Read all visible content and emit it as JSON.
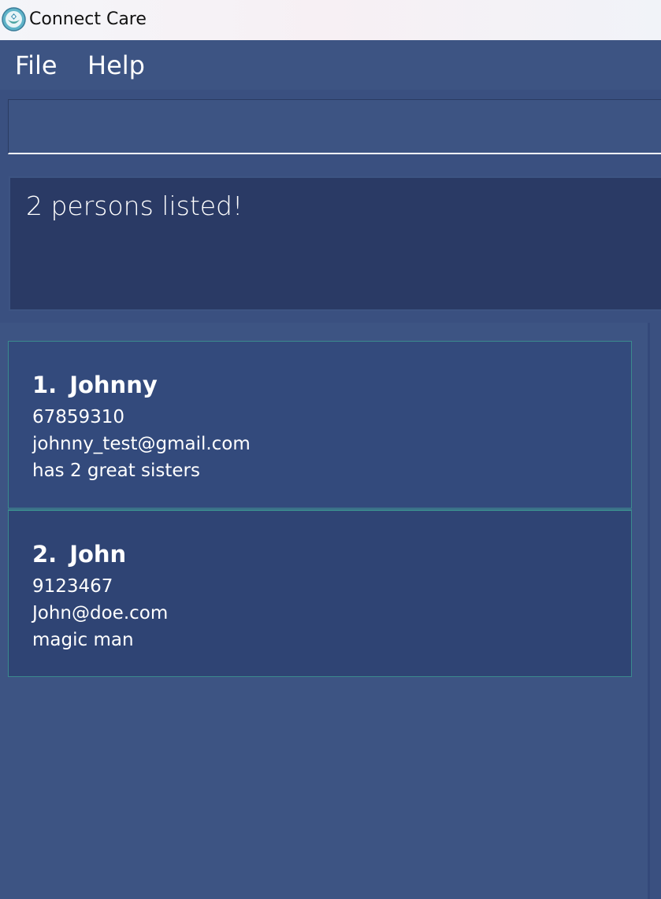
{
  "window": {
    "title": "Connect Care",
    "logo_icon": "connect-care-logo"
  },
  "menu": {
    "items": [
      {
        "label": "File"
      },
      {
        "label": "Help"
      }
    ]
  },
  "command": {
    "value": "",
    "placeholder": ""
  },
  "result": {
    "message": "2 persons listed!"
  },
  "persons": [
    {
      "index": "1.",
      "name": "Johnny",
      "phone": "67859310",
      "email": "johnny_test@gmail.com",
      "description": "has 2 great sisters"
    },
    {
      "index": "2.",
      "name": "John",
      "phone": "9123467",
      "email": "John@doe.com",
      "description": "magic man"
    }
  ],
  "colors": {
    "background": "#3d5483",
    "result_box": "#2a3a65",
    "card_border": "#3b8a8e"
  }
}
